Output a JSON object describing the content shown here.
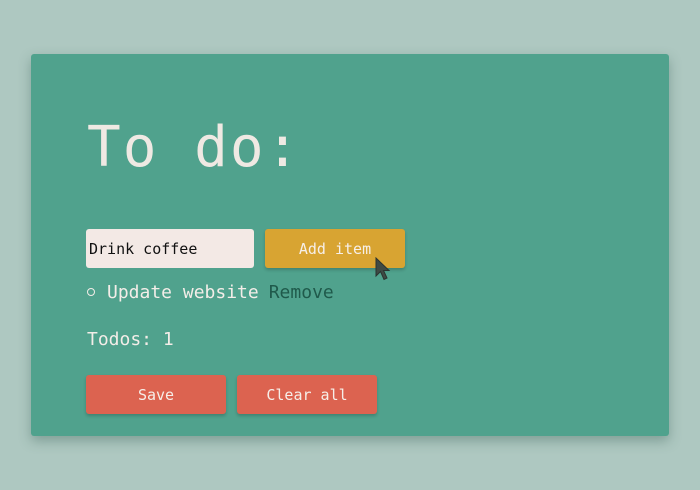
{
  "app": {
    "title": "To do:"
  },
  "form": {
    "input_value": "Drink coffee",
    "add_button_label": "Add item"
  },
  "todos": [
    {
      "text": "Update website",
      "remove_label": "Remove"
    }
  ],
  "counter": {
    "text": "Todos: 1"
  },
  "actions": {
    "save_label": "Save",
    "clear_label": "Clear all"
  },
  "colors": {
    "page_background": "#aec8c1",
    "card_background": "#50a28d",
    "add_button": "#d8a432",
    "action_buttons": "#dc6350",
    "remove_link": "#1f5a4b"
  },
  "icons": {
    "cursor": "mouse-pointer-icon",
    "bullet": "hollow-circle-bullet-icon"
  }
}
